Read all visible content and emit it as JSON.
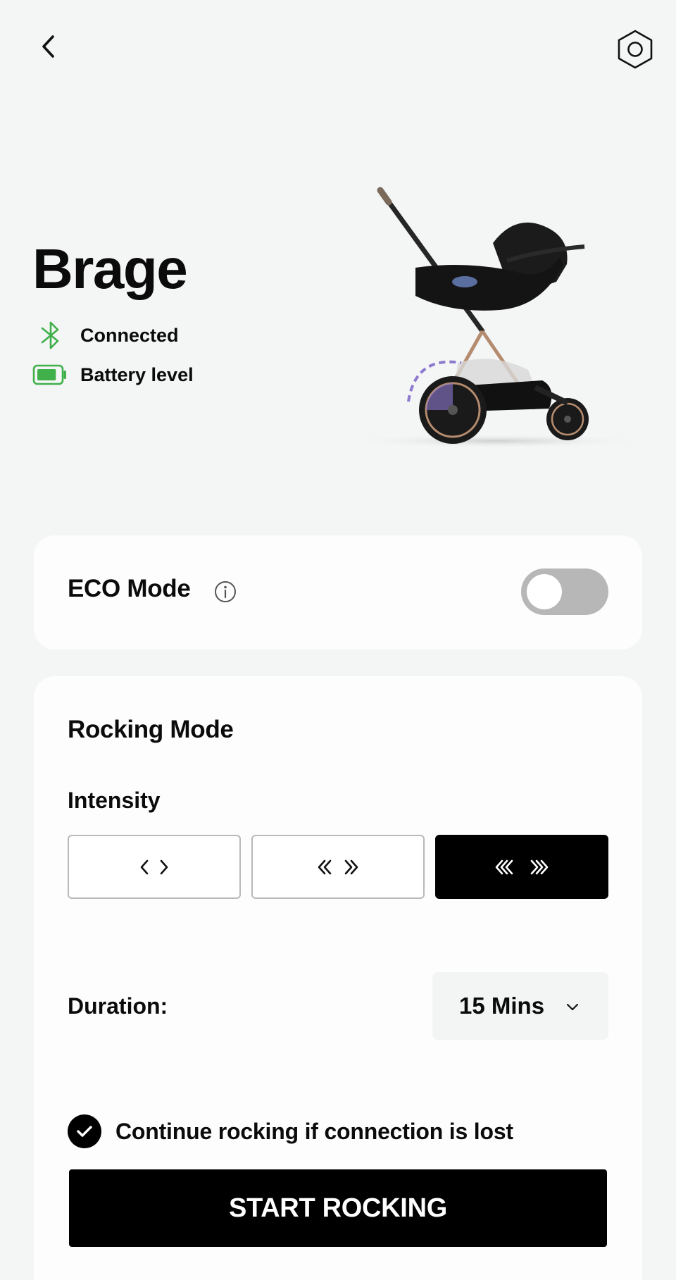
{
  "device": {
    "name": "Brage",
    "connection_status": "Connected",
    "battery_label": "Battery level",
    "battery_fraction": 0.85
  },
  "colors": {
    "status_green": "#3fb04a",
    "toggle_off": "#b7b7b7",
    "arc_purple": "#8d7ad0"
  },
  "icons": {
    "back": "chevron-left-icon",
    "settings": "hexagon-settings-icon",
    "bluetooth": "bluetooth-icon",
    "battery": "battery-icon",
    "info": "info-icon"
  },
  "eco": {
    "label": "ECO Mode",
    "enabled": false
  },
  "rocking": {
    "title": "Rocking Mode",
    "intensity_label": "Intensity",
    "intensity_levels": [
      "low",
      "medium",
      "high"
    ],
    "selected_intensity": "high",
    "duration_label": "Duration:",
    "duration_value": "15 Mins",
    "continue_label": "Continue rocking if connection is lost",
    "continue_checked": true,
    "start_label": "START ROCKING"
  }
}
